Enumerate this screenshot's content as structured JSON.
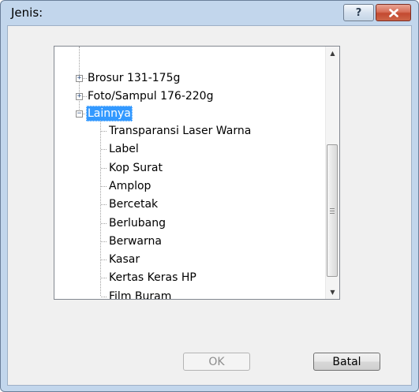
{
  "dialog": {
    "title": "Jenis:",
    "help_glyph": "?",
    "close_glyph": "✕"
  },
  "tree": {
    "expanded_children": [
      "Transparansi Laser Warna",
      "Label",
      "Kop Surat",
      "Amplop",
      "Bercetak",
      "Berlubang",
      "Berwarna",
      "Kasar",
      "Kertas Keras HP",
      "Film Buram"
    ],
    "nodes": {
      "brosur": "Brosur 131-175g",
      "foto": "Foto/Sampul 176-220g",
      "lainnya": "Lainnya"
    },
    "selected": "Lainnya"
  },
  "scrollbar": {
    "up_glyph": "▲",
    "down_glyph": "▼"
  },
  "buttons": {
    "ok_label": "OK",
    "cancel_label": "Batal",
    "ok_enabled": false
  },
  "colors": {
    "selection": "#3399ff",
    "window_frame": "#c2d6ec",
    "close_button": "#c8533a"
  },
  "icons": {
    "collapsed": "plus-box",
    "expanded": "minus-box"
  }
}
